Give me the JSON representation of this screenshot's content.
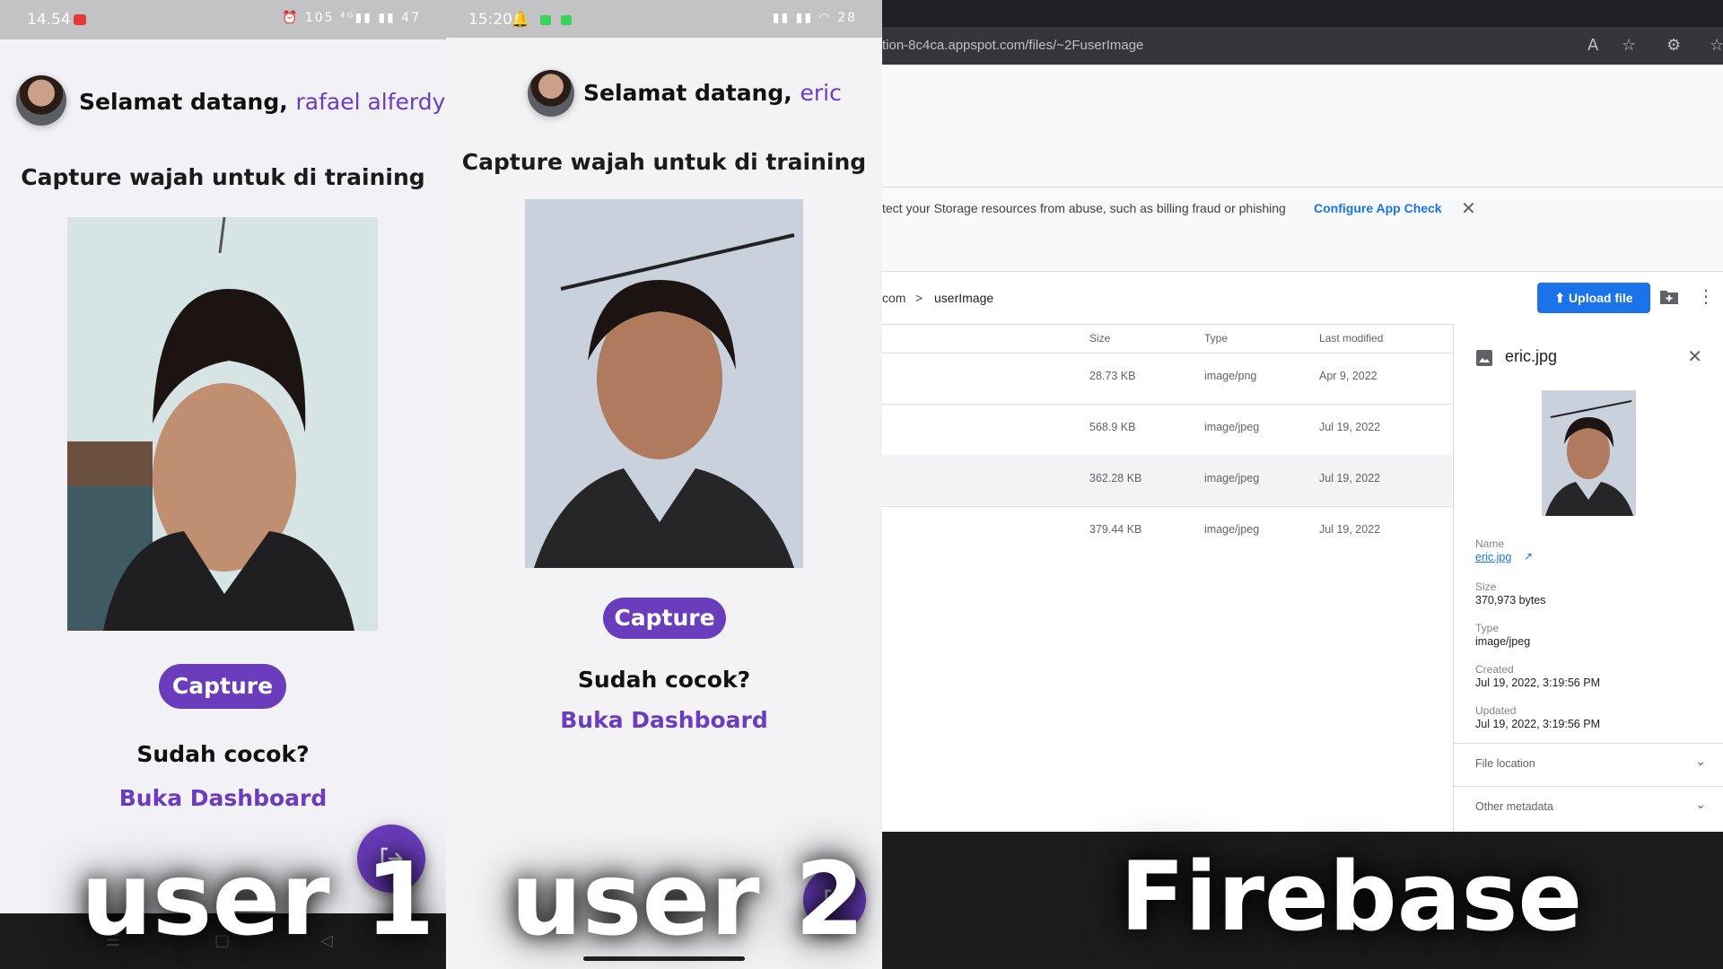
{
  "user1": {
    "status_time": "14.54",
    "status_icons": "⏰ 105 ⁴ᴳ▮▮ ▮▮ 47",
    "greeting_prefix": "Selamat datang,",
    "username": "rafael alferdyas",
    "heading": "Capture wajah untuk di training",
    "capture_label": "Capture",
    "question": "Sudah cocok?",
    "dashboard_link": "Buka Dashboard",
    "overlay_label": "user 1"
  },
  "user2": {
    "status_time": "15:20",
    "status_icons": "▮▮ ▮▮ ◠ 28",
    "greeting_prefix": "Selamat datang,",
    "username": "eric",
    "heading": "Capture wajah untuk di training",
    "capture_label": "Capture",
    "question": "Sudah cocok?",
    "dashboard_link": "Buka Dashboard",
    "overlay_label": "user 2"
  },
  "firebase": {
    "url": "tion-8c4ca.appspot.com/files/~2FuserImage",
    "banner_text": "tect your Storage resources from abuse, such as billing fraud or phishing",
    "banner_link": "Configure App Check",
    "breadcrumb_root": "com",
    "breadcrumb_sep": ">",
    "breadcrumb_folder": "userImage",
    "upload_label": "Upload file",
    "columns": {
      "size": "Size",
      "type": "Type",
      "modified": "Last modified"
    },
    "rows": [
      {
        "size": "28.73 KB",
        "type": "image/png",
        "modified": "Apr 9, 2022"
      },
      {
        "size": "568.9 KB",
        "type": "image/jpeg",
        "modified": "Jul 19, 2022"
      },
      {
        "size": "362.28 KB",
        "type": "image/jpeg",
        "modified": "Jul 19, 2022"
      },
      {
        "size": "379.44 KB",
        "type": "image/jpeg",
        "modified": "Jul 19, 2022"
      }
    ],
    "detail": {
      "title": "eric.jpg",
      "name_label": "Name",
      "name_value": "eric.jpg",
      "size_label": "Size",
      "size_value": "370,973 bytes",
      "type_label": "Type",
      "type_value": "image/jpeg",
      "created_label": "Created",
      "created_value": "Jul 19, 2022, 3:19:56 PM",
      "updated_label": "Updated",
      "updated_value": "Jul 19, 2022, 3:19:56 PM",
      "file_location": "File location",
      "other_metadata": "Other metadata"
    },
    "overlay_label": "Firebase"
  },
  "colors": {
    "accent_purple": "#6a3dbd",
    "firebase_blue": "#1a73e8"
  }
}
